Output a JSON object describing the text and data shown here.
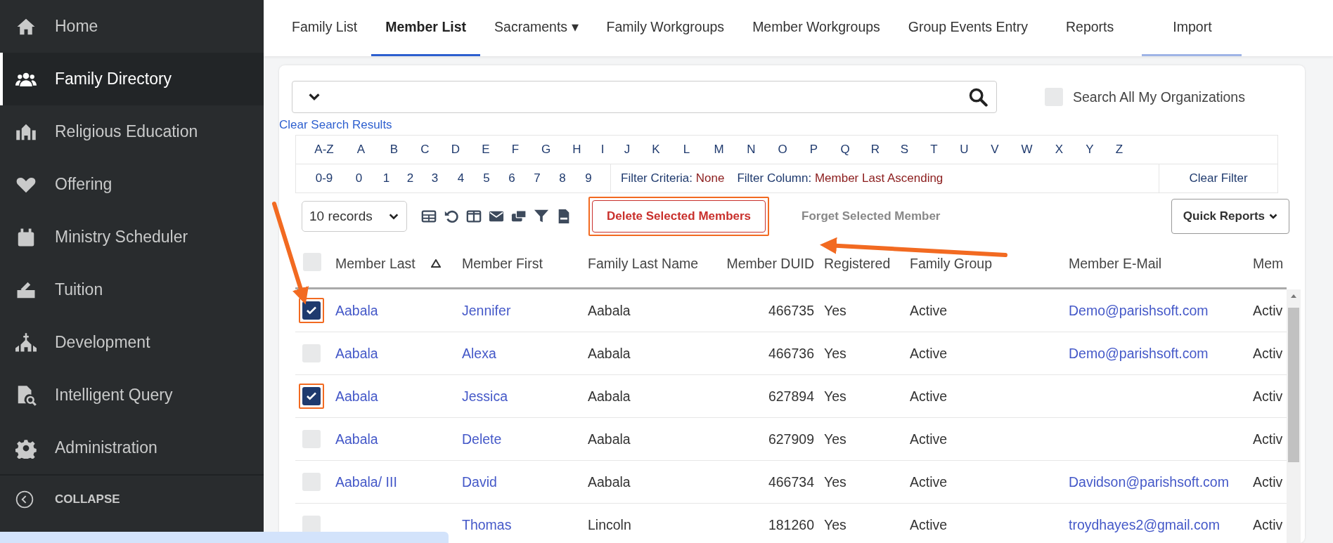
{
  "sidebar": {
    "items": [
      {
        "label": "Home",
        "selected": false
      },
      {
        "label": "Family Directory",
        "selected": true
      },
      {
        "label": "Religious Education",
        "selected": false
      },
      {
        "label": "Offering",
        "selected": false
      },
      {
        "label": "Ministry Scheduler",
        "selected": false
      },
      {
        "label": "Tuition",
        "selected": false
      },
      {
        "label": "Development",
        "selected": false
      },
      {
        "label": "Intelligent Query",
        "selected": false
      },
      {
        "label": "Administration",
        "selected": false
      }
    ],
    "collapse": "COLLAPSE"
  },
  "tabs": [
    {
      "label": "Family List",
      "selected": false,
      "hovered": false
    },
    {
      "label": "Member List",
      "selected": true,
      "hovered": false
    },
    {
      "label": "Sacraments ▾",
      "selected": false,
      "hovered": false
    },
    {
      "label": "Family Workgroups",
      "selected": false,
      "hovered": false
    },
    {
      "label": "Member Workgroups",
      "selected": false,
      "hovered": false
    },
    {
      "label": "Group Events Entry",
      "selected": false,
      "hovered": false
    },
    {
      "label": "Reports",
      "selected": false,
      "hovered": false
    },
    {
      "label": "Import",
      "selected": false,
      "hovered": true
    }
  ],
  "search": {
    "all_orgs_label": "Search All My Organizations",
    "all_orgs_checked": false,
    "clear_link": "Clear Search Results"
  },
  "alphabet": {
    "letters": [
      "A-Z",
      "A",
      "B",
      "C",
      "D",
      "E",
      "F",
      "G",
      "H",
      "I",
      "J",
      "K",
      "L",
      "M",
      "N",
      "O",
      "P",
      "Q",
      "R",
      "S",
      "T",
      "U",
      "V",
      "W",
      "X",
      "Y",
      "Z"
    ],
    "digits": [
      "0-9",
      "0",
      "1",
      "2",
      "3",
      "4",
      "5",
      "6",
      "7",
      "8",
      "9"
    ],
    "filter_criteria_label": "Filter Criteria:",
    "filter_criteria_value": "None",
    "filter_column_label": "Filter Column:",
    "filter_column_value": "Member Last Ascending",
    "clear_filter": "Clear Filter"
  },
  "toolbar": {
    "page_size": "10 records",
    "delete_button": "Delete Selected Members",
    "delete_highlighted": true,
    "forget_button": "Forget Selected Member",
    "quick_reports": "Quick Reports"
  },
  "table": {
    "all_selected": false,
    "columns": [
      "Member Last",
      "Member First",
      "Family Last Name",
      "Member DUID",
      "Registered",
      "Family Group",
      "Member E-Mail",
      "Mem"
    ],
    "rows": [
      {
        "checked": true,
        "highlighted": true,
        "cells": [
          "Aabala",
          "Jennifer",
          "Aabala",
          "466735",
          "Yes",
          "Active",
          "Demo@parishsoft.com",
          "Activ"
        ]
      },
      {
        "checked": false,
        "highlighted": false,
        "cells": [
          "Aabala",
          "Alexa",
          "Aabala",
          "466736",
          "Yes",
          "Active",
          "Demo@parishsoft.com",
          "Activ"
        ]
      },
      {
        "checked": true,
        "highlighted": true,
        "cells": [
          "Aabala",
          "Jessica",
          "Aabala",
          "627894",
          "Yes",
          "Active",
          "",
          "Activ"
        ]
      },
      {
        "checked": false,
        "highlighted": false,
        "cells": [
          "Aabala",
          "Delete",
          "Aabala",
          "627909",
          "Yes",
          "Active",
          "",
          "Activ"
        ]
      },
      {
        "checked": false,
        "highlighted": false,
        "cells": [
          "Aabala/ III",
          "David",
          "Aabala",
          "466734",
          "Yes",
          "Active",
          "Davidson@parishsoft.com",
          "Activ"
        ]
      },
      {
        "checked": false,
        "highlighted": false,
        "cells": [
          "",
          "Thomas",
          "Lincoln",
          "181260",
          "Yes",
          "Active",
          "troydhayes2@gmail.com",
          "Activ"
        ]
      }
    ]
  }
}
